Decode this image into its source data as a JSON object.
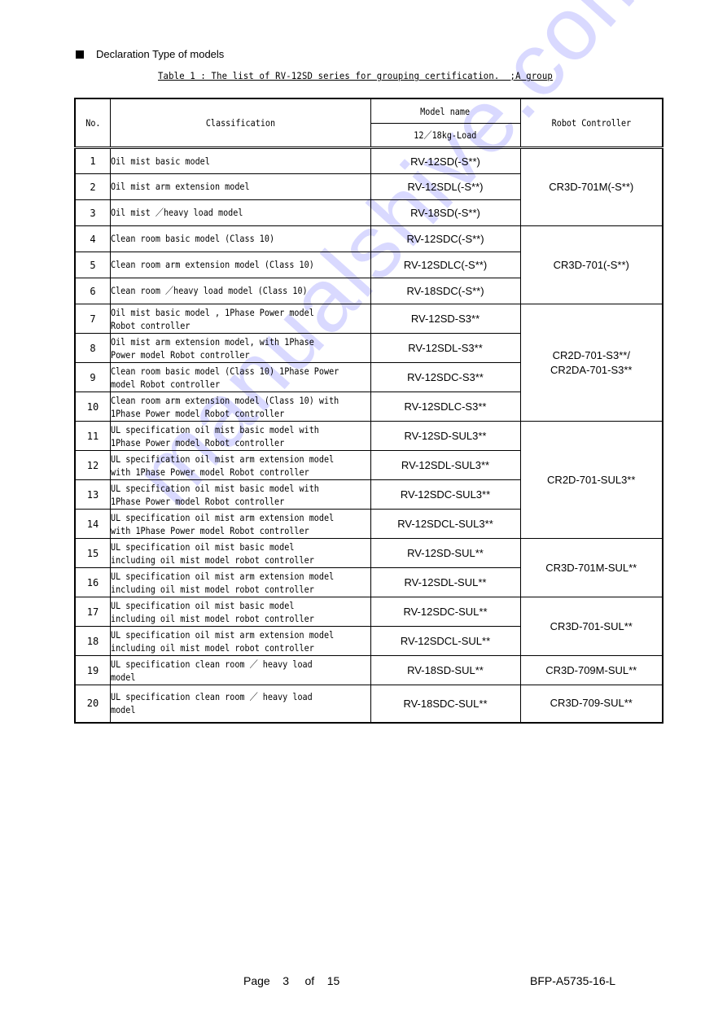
{
  "heading": "Declaration Type of models",
  "caption": "Table 1 : The list of RV-12SD series for grouping certification.  ;A group",
  "table": {
    "headers": {
      "no": "No.",
      "classification": "Classification",
      "model_name": "Model name",
      "model_sub": "12／18kg-Load",
      "controller": "Robot Controller"
    },
    "rows": [
      {
        "no": "1",
        "classification": [
          "Oil mist basic model"
        ],
        "model": "RV-12SD(-S**)"
      },
      {
        "no": "2",
        "classification": [
          "Oil mist arm extension model"
        ],
        "model": "RV-12SDL(-S**)"
      },
      {
        "no": "3",
        "classification": [
          "Oil mist ／heavy load model"
        ],
        "model": "RV-18SD(-S**)"
      },
      {
        "no": "4",
        "classification": [
          "Clean room basic model (Class 10)"
        ],
        "model": "RV-12SDC(-S**)"
      },
      {
        "no": "5",
        "classification": [
          "Clean room arm extension model (Class 10)"
        ],
        "model": "RV-12SDLC(-S**)"
      },
      {
        "no": "6",
        "classification": [
          "Clean room ／heavy load model (Class 10)"
        ],
        "model": "RV-18SDC(-S**)"
      },
      {
        "no": "7",
        "classification": [
          "Oil mist basic model , 1Phase Power model",
          "Robot controller"
        ],
        "model": "RV-12SD-S3**"
      },
      {
        "no": "8",
        "classification": [
          "Oil mist arm extension model, with 1Phase",
          "Power model Robot controller"
        ],
        "model": "RV-12SDL-S3**"
      },
      {
        "no": "9",
        "classification": [
          "Clean room basic model (Class 10) 1Phase Power",
          "model Robot controller"
        ],
        "model": "RV-12SDC-S3**"
      },
      {
        "no": "10",
        "classification": [
          "Clean room arm extension model (Class 10) with",
          "1Phase Power model Robot controller"
        ],
        "model": "RV-12SDLC-S3**"
      },
      {
        "no": "11",
        "classification": [
          "UL specification oil mist basic model with",
          "1Phase Power model Robot controller"
        ],
        "model": "RV-12SD-SUL3**"
      },
      {
        "no": "12",
        "classification": [
          "UL specification oil mist arm extension model",
          "with 1Phase Power model Robot controller"
        ],
        "model": "RV-12SDL-SUL3**"
      },
      {
        "no": "13",
        "classification": [
          "UL specification oil mist basic model with",
          "1Phase Power model Robot controller"
        ],
        "model": "RV-12SDC-SUL3**"
      },
      {
        "no": "14",
        "classification": [
          "UL specification oil mist arm extension model",
          "with 1Phase Power model Robot controller"
        ],
        "model": "RV-12SDCL-SUL3**"
      },
      {
        "no": "15",
        "classification": [
          "UL specification oil mist basic model",
          "including oil mist model robot controller"
        ],
        "model": "RV-12SD-SUL**"
      },
      {
        "no": "16",
        "classification": [
          "UL specification oil mist arm extension model",
          "including oil mist model robot controller"
        ],
        "model": "RV-12SDL-SUL**"
      },
      {
        "no": "17",
        "classification": [
          "UL specification oil mist basic model",
          "including oil mist model robot controller"
        ],
        "model": "RV-12SDC-SUL**"
      },
      {
        "no": "18",
        "classification": [
          "UL specification oil mist arm extension model",
          "including oil mist model robot controller"
        ],
        "model": "RV-12SDCL-SUL**"
      },
      {
        "no": "19",
        "classification": [
          "UL specification clean room ／ heavy load",
          "model"
        ],
        "model": "RV-18SD-SUL**"
      },
      {
        "no": "20",
        "classification": [
          "UL specification clean room ／ heavy load",
          "model"
        ],
        "model": "RV-18SDC-SUL**"
      }
    ],
    "controllers": [
      {
        "lines": [
          "CR3D-701M(-S**)"
        ],
        "rows": 3
      },
      {
        "lines": [
          "CR3D-701(-S**)"
        ],
        "rows": 3
      },
      {
        "lines": [
          "CR2D-701-S3**/",
          "CR2DA-701-S3**"
        ],
        "rows": 4
      },
      {
        "lines": [
          "CR2D-701-SUL3**"
        ],
        "rows": 4
      },
      {
        "lines": [
          "CR3D-701M-SUL**"
        ],
        "rows": 2
      },
      {
        "lines": [
          "CR3D-701-SUL**"
        ],
        "rows": 2
      },
      {
        "lines": [
          "CR3D-709M-SUL**"
        ],
        "rows": 1
      },
      {
        "lines": [
          "CR3D-709-SUL**"
        ],
        "rows": 1
      }
    ]
  },
  "footer": {
    "page_label": "Page",
    "page_current": "3",
    "page_of": "of",
    "page_total": "15",
    "doc_code": "BFP-A5735-16-L"
  },
  "watermark": "manualshive.com"
}
